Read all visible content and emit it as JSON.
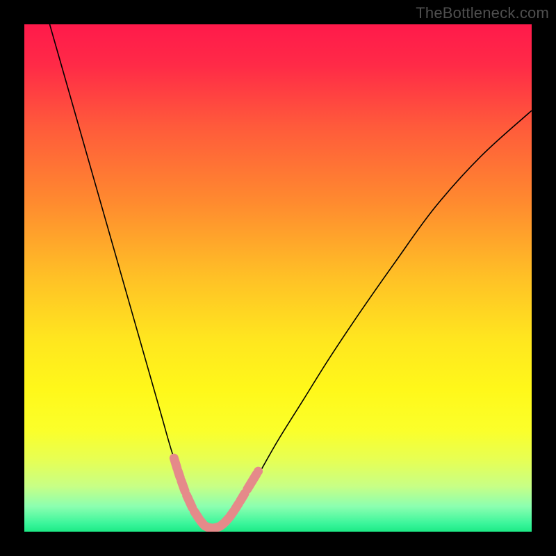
{
  "watermark": "TheBottleneck.com",
  "chart_data": {
    "type": "line",
    "title": "",
    "xlabel": "",
    "ylabel": "",
    "xlim": [
      0,
      100
    ],
    "ylim": [
      0,
      100
    ],
    "background_gradient": {
      "stops": [
        {
          "offset": 0.0,
          "color": "#ff1a4b"
        },
        {
          "offset": 0.08,
          "color": "#ff2a47"
        },
        {
          "offset": 0.2,
          "color": "#ff5a3b"
        },
        {
          "offset": 0.35,
          "color": "#ff8a2f"
        },
        {
          "offset": 0.5,
          "color": "#ffc126"
        },
        {
          "offset": 0.62,
          "color": "#ffe61f"
        },
        {
          "offset": 0.72,
          "color": "#fff81a"
        },
        {
          "offset": 0.8,
          "color": "#fbff2a"
        },
        {
          "offset": 0.86,
          "color": "#e6ff55"
        },
        {
          "offset": 0.91,
          "color": "#c8ff85"
        },
        {
          "offset": 0.95,
          "color": "#8cffb0"
        },
        {
          "offset": 0.985,
          "color": "#38f59a"
        },
        {
          "offset": 1.0,
          "color": "#1de985"
        }
      ]
    },
    "series": [
      {
        "name": "bottleneck-curve",
        "stroke": "#000000",
        "stroke_width": 1.6,
        "x": [
          5,
          7,
          9,
          11,
          13,
          15,
          17,
          19,
          21,
          23,
          25,
          27,
          29,
          31,
          32.5,
          34,
          35.5,
          37,
          38.5,
          40,
          43,
          46,
          50,
          55,
          60,
          66,
          73,
          81,
          90,
          100
        ],
        "y": [
          100,
          93,
          86,
          79,
          72,
          65,
          58,
          51,
          44,
          37,
          30,
          23,
          16,
          10,
          6,
          3,
          1.2,
          0.6,
          1.0,
          2.2,
          6,
          11,
          18,
          26,
          34,
          43,
          53,
          64,
          74,
          83
        ]
      }
    ],
    "marker_overlay": {
      "name": "bottom-band-markers",
      "stroke": "#e58a8a",
      "stroke_width": 13,
      "linecap": "round",
      "points": [
        {
          "x": 29.5,
          "y": 14.5
        },
        {
          "x": 30.2,
          "y": 12.2
        },
        {
          "x": 30.8,
          "y": 10.4
        },
        {
          "x": 31.8,
          "y": 7.6
        },
        {
          "x": 33.3,
          "y": 4.3
        },
        {
          "x": 34.6,
          "y": 2.3
        },
        {
          "x": 35.5,
          "y": 1.2
        },
        {
          "x": 36.3,
          "y": 0.8
        },
        {
          "x": 36.9,
          "y": 0.7
        },
        {
          "x": 37.4,
          "y": 0.7
        },
        {
          "x": 38.5,
          "y": 1.0
        },
        {
          "x": 39.4,
          "y": 1.7
        },
        {
          "x": 40.4,
          "y": 2.8
        },
        {
          "x": 41.4,
          "y": 4.2
        },
        {
          "x": 42.4,
          "y": 5.8
        },
        {
          "x": 43.6,
          "y": 7.8
        },
        {
          "x": 46.1,
          "y": 11.9
        }
      ]
    }
  }
}
